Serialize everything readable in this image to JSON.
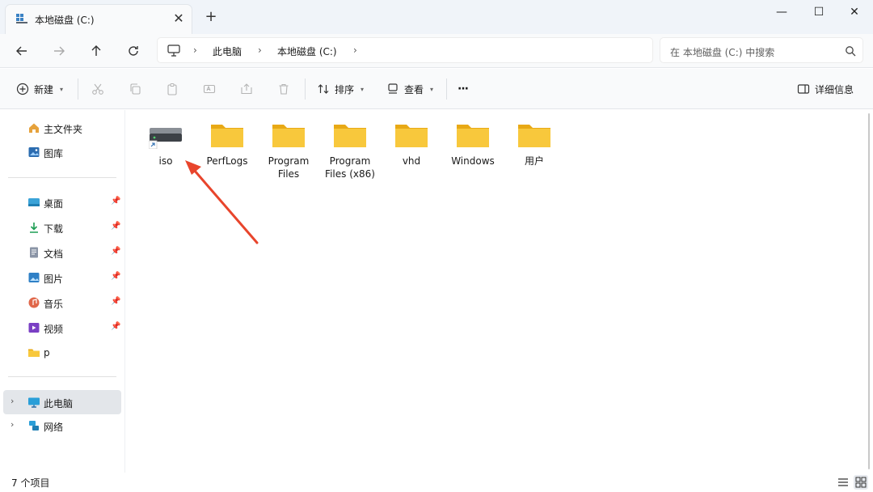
{
  "tab": {
    "title": "本地磁盘 (C:)",
    "close_glyph": "✕",
    "new_glyph": "+"
  },
  "window": {
    "minimize_glyph": "—",
    "maximize_glyph": "☐",
    "close_glyph": "✕"
  },
  "address": {
    "parts": [
      "此电脑",
      "本地磁盘 (C:)"
    ],
    "separator": "›",
    "search_placeholder": "在 本地磁盘 (C:) 中搜索"
  },
  "commands": {
    "new_label": "新建",
    "sort_label": "排序",
    "view_label": "查看",
    "more_label": "···",
    "details_label": "详细信息"
  },
  "sidebar": {
    "quick": [
      {
        "label": "主文件夹",
        "icon": "home-icon"
      },
      {
        "label": "图库",
        "icon": "gallery-icon"
      }
    ],
    "pinned": [
      {
        "label": "桌面",
        "icon": "desktop-icon"
      },
      {
        "label": "下载",
        "icon": "download-icon"
      },
      {
        "label": "文档",
        "icon": "document-icon"
      },
      {
        "label": "图片",
        "icon": "pictures-icon"
      },
      {
        "label": "音乐",
        "icon": "music-icon"
      },
      {
        "label": "视频",
        "icon": "video-icon"
      },
      {
        "label": "p",
        "icon": "folder-icon"
      }
    ],
    "devices": [
      {
        "label": "此电脑",
        "icon": "pc-icon"
      },
      {
        "label": "网络",
        "icon": "network-icon"
      }
    ],
    "pin_glyph": "📌",
    "chevron_glyph": "›"
  },
  "files": [
    {
      "name": "iso",
      "icon": "drive-shortcut-icon"
    },
    {
      "name": "PerfLogs",
      "icon": "folder-icon"
    },
    {
      "name": "Program Files",
      "icon": "folder-icon"
    },
    {
      "name": "Program Files (x86)",
      "icon": "folder-icon"
    },
    {
      "name": "vhd",
      "icon": "folder-icon"
    },
    {
      "name": "Windows",
      "icon": "folder-icon"
    },
    {
      "name": "用户",
      "icon": "folder-icon"
    }
  ],
  "status": {
    "item_count": "7 个项目"
  },
  "colors": {
    "folder": "#f8c83c",
    "folder_dark": "#e8a916",
    "accent": "#0067c0",
    "annotation_arrow": "#e8452c"
  }
}
